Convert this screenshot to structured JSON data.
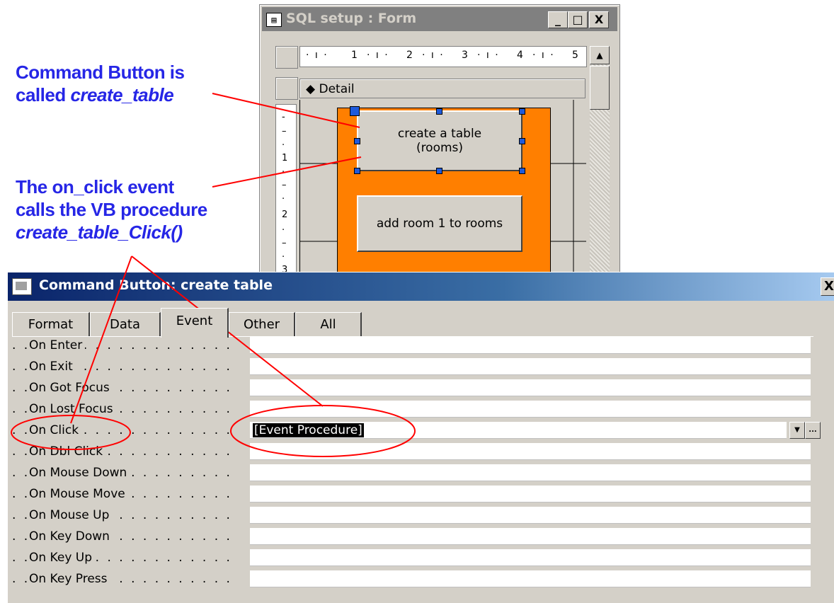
{
  "annotations": {
    "note1_line1": "Command Button is",
    "note1_line2_prefix": "called ",
    "note1_line2_italic": "create_table",
    "note2_line1": "The on_click event",
    "note2_line2": "calls the VB procedure",
    "note2_line3_italic": "create_table_Click()",
    "line_color": "#ff0000"
  },
  "form_window": {
    "title": "SQL setup : Form",
    "title_icon": "form-icon",
    "minimize": "_",
    "maximize": "□",
    "close": "X",
    "ruler_numbers": [
      "1",
      "2",
      "3",
      "4",
      "5"
    ],
    "vertical_ruler_numbers": [
      "1",
      "2",
      "3"
    ],
    "section_label": "Detail",
    "section_icon": "detail-arrow-icon",
    "button1_line1": "create a table",
    "button1_line2": "(rooms)",
    "button2_label": "add room 1 to rooms",
    "background_color": "#ff7f00"
  },
  "property_sheet": {
    "title": "Command Button: create table",
    "title_icon": "property-sheet-icon",
    "close": "X",
    "tabs": [
      "Format",
      "Data",
      "Event",
      "Other",
      "All"
    ],
    "active_tab": "Event",
    "rows": [
      {
        "label": "On Enter",
        "value": ""
      },
      {
        "label": "On Exit",
        "value": ""
      },
      {
        "label": "On Got Focus",
        "value": ""
      },
      {
        "label": "On Lost Focus",
        "value": ""
      },
      {
        "label": "On Click",
        "value": "[Event Procedure]"
      },
      {
        "label": "On Dbl Click",
        "value": ""
      },
      {
        "label": "On Mouse Down",
        "value": ""
      },
      {
        "label": "On Mouse Move",
        "value": ""
      },
      {
        "label": "On Mouse Up",
        "value": ""
      },
      {
        "label": "On Key Down",
        "value": ""
      },
      {
        "label": "On Key Up",
        "value": ""
      },
      {
        "label": "On Key Press",
        "value": ""
      }
    ],
    "dropdown_glyph": "▼",
    "builder_glyph": "..."
  }
}
